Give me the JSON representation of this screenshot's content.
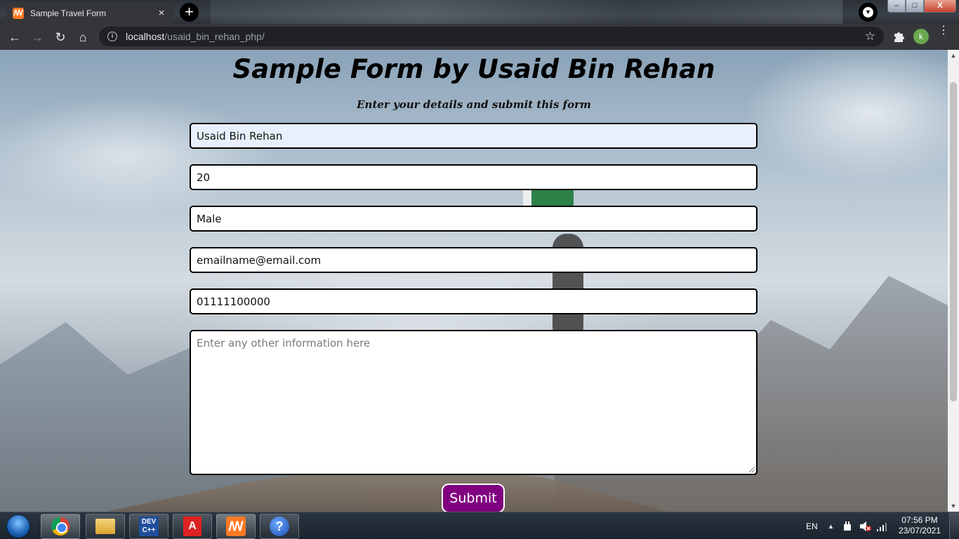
{
  "browser": {
    "tab": {
      "title": "Sample Travel Form",
      "favicon": "xampp-icon",
      "close": "×"
    },
    "new_tab": "+",
    "address": {
      "host": "localhost",
      "path": "/usaid_bin_rehan_php/"
    },
    "profile_initial": "k",
    "nav": {
      "back": "←",
      "forward": "→",
      "reload": "↻",
      "home": "⌂",
      "star": "☆",
      "menu": "⋮"
    },
    "window_controls": {
      "minimize": "–",
      "maximize": "□",
      "close": "X"
    }
  },
  "page": {
    "title": "Sample Form by Usaid Bin Rehan",
    "subtitle": "Enter your details and submit this form",
    "fields": {
      "name": "Usaid Bin Rehan",
      "age": "20",
      "gender": "Male",
      "email": "emailname@email.com",
      "phone": "01111100000"
    },
    "description_placeholder": "Enter any other information here",
    "submit_label": "Submit"
  },
  "taskbar": {
    "apps": [
      "start-orb",
      "chrome-icon",
      "file-explorer-icon",
      "devc-icon",
      "acrobat-icon",
      "xampp-icon",
      "help-icon"
    ],
    "devc_label": "DEV C++",
    "pdf_label": "A",
    "xampp_label": "ꟿ",
    "help_label": "?",
    "language": "EN",
    "tray_arrow": "▲",
    "time": "07:56 PM",
    "date": "23/07/2021"
  },
  "colors": {
    "submit_bg": "#800080",
    "autofill_bg": "#e8f0fe",
    "tab_favicon": "#fb7a24"
  }
}
